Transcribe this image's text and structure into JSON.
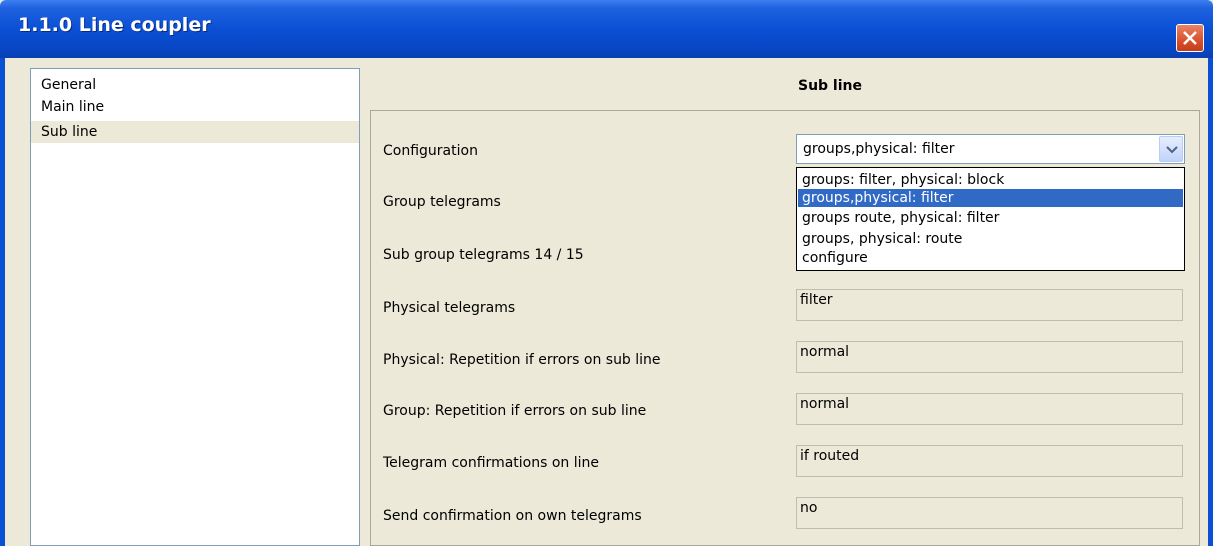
{
  "window": {
    "title": "1.1.0 Line coupler"
  },
  "nav": {
    "items": [
      {
        "label": "General"
      },
      {
        "label": "Main line"
      },
      {
        "label": "Sub line"
      }
    ]
  },
  "section": {
    "title": "Sub line"
  },
  "configuration": {
    "label": "Configuration",
    "value": "groups,physical: filter",
    "options": [
      "groups: filter, physical: block",
      "groups,physical: filter",
      "groups route, physical: filter",
      "groups, physical: route",
      "configure"
    ],
    "highlighted_option": "groups,physical: filter"
  },
  "rows": [
    {
      "label": "Group telegrams"
    },
    {
      "label": "Sub group telegrams 14 / 15"
    },
    {
      "label": "Physical telegrams",
      "value": "filter"
    },
    {
      "label": "Physical: Repetition if errors on sub line",
      "value": "normal"
    },
    {
      "label": "Group: Repetition if errors on sub line",
      "value": "normal"
    },
    {
      "label": "Telegram confirmations on line",
      "value": "if routed"
    },
    {
      "label": "Send confirmation on own telegrams",
      "value": "no"
    }
  ]
}
